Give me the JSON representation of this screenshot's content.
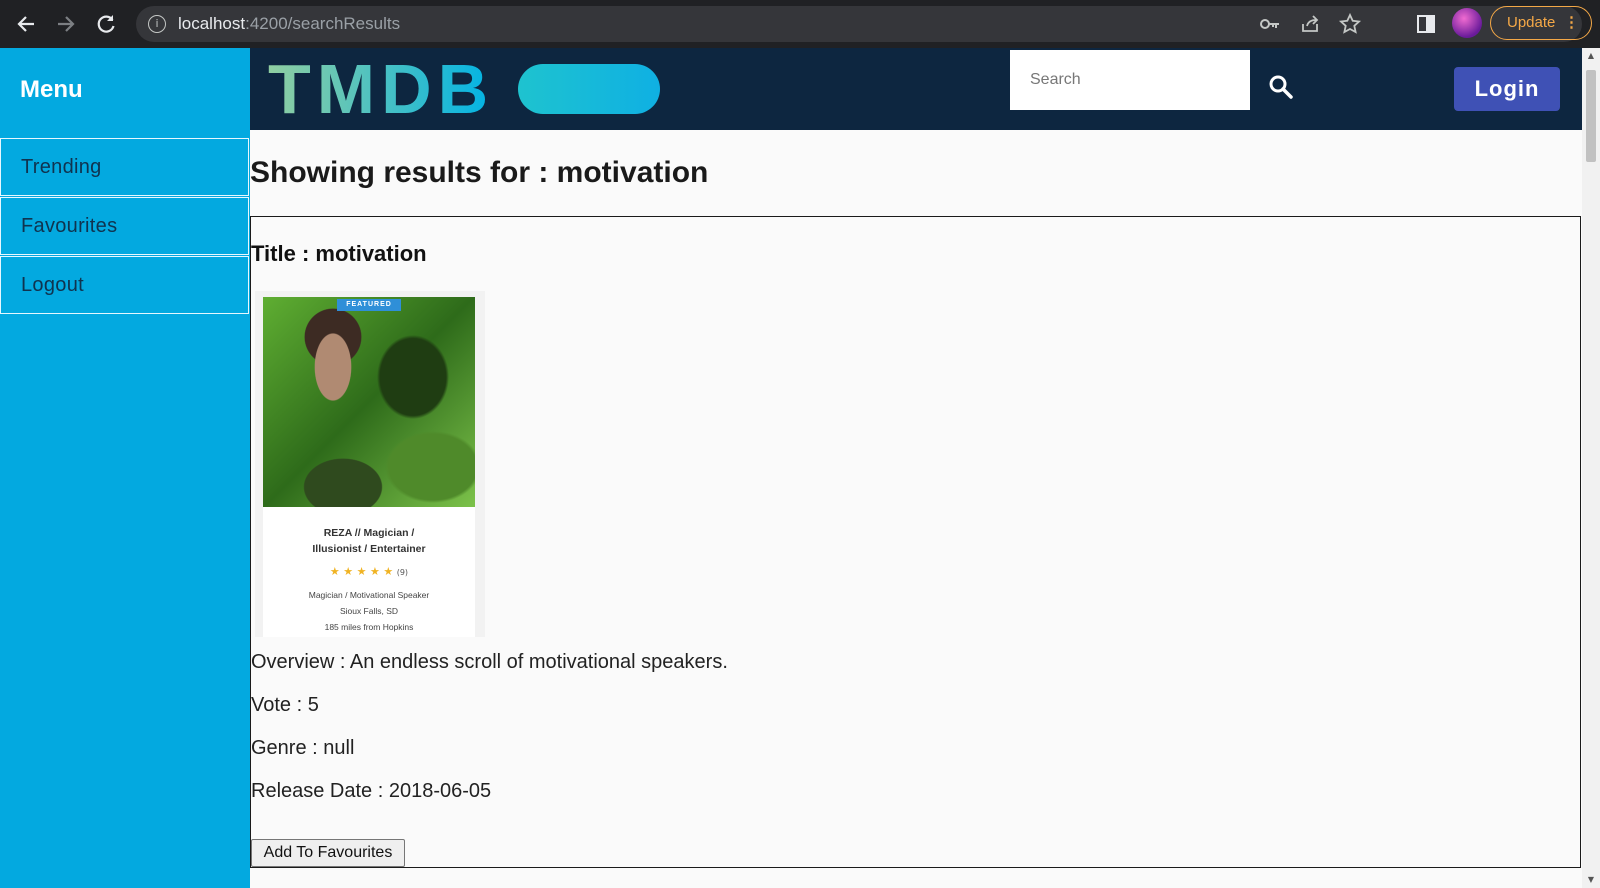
{
  "browser": {
    "url_host": "localhost",
    "url_path": ":4200/searchResults",
    "update_label": "Update",
    "icons": [
      "back-icon",
      "forward-icon",
      "reload-icon",
      "info-icon",
      "key-icon",
      "share-icon",
      "star-icon",
      "side-panel-icon",
      "profile-avatar",
      "more-icon"
    ]
  },
  "sidebar": {
    "title": "Menu",
    "items": [
      {
        "label": "Trending"
      },
      {
        "label": "Favourites"
      },
      {
        "label": "Logout"
      }
    ]
  },
  "header": {
    "logo": "TMDB",
    "search_placeholder": "Search",
    "search_value": "",
    "login_label": "Login"
  },
  "results": {
    "heading": "Showing results for : motivation",
    "item": {
      "title": "Title : motivation",
      "poster": {
        "badge": "FEATURED",
        "name_line1": "REZA // Magician /",
        "name_line2": "Illusionist / Entertainer",
        "stars": "★ ★ ★ ★ ★",
        "rating_count": "(9)",
        "meta_line1": "Magician / Motivational Speaker",
        "meta_line2": "Sioux Falls, SD",
        "meta_line3": "185 miles from Hopkins"
      },
      "overview": "Overview : An endless scroll of motivational speakers.",
      "vote": "Vote : 5",
      "genre": "Genre : null",
      "release_date": "Release Date : 2018-06-05",
      "add_button": "Add To Favourites"
    }
  },
  "colors": {
    "sidebar_bg": "#03a9e0",
    "header_bg": "#0d2640",
    "login_bg": "#3f51b5",
    "update_accent": "#f4a847"
  }
}
